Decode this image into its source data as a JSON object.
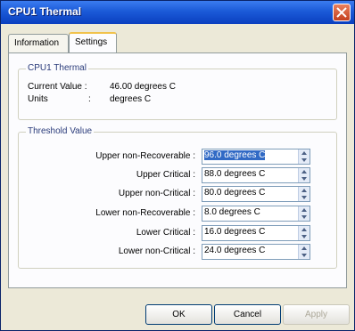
{
  "window": {
    "title": "CPU1 Thermal"
  },
  "tabs": [
    {
      "label": "Information",
      "active": false
    },
    {
      "label": "Settings",
      "active": true
    }
  ],
  "sensor_group": {
    "legend": "CPU1 Thermal",
    "current_value_label": "Current Value :",
    "current_value": "46.00 degrees C",
    "units_label": "Units",
    "units_sep": ":",
    "units_value": "degrees C"
  },
  "threshold_group": {
    "legend": "Threshold Value",
    "rows": [
      {
        "label": "Upper non-Recoverable :",
        "value": "96.0 degrees C",
        "selected": true
      },
      {
        "label": "Upper Critical :",
        "value": "88.0 degrees C",
        "selected": false
      },
      {
        "label": "Upper non-Critical :",
        "value": "80.0 degrees C",
        "selected": false
      },
      {
        "label": "Lower non-Recoverable :",
        "value": "8.0 degrees C",
        "selected": false
      },
      {
        "label": "Lower Critical :",
        "value": "16.0 degrees C",
        "selected": false
      },
      {
        "label": "Lower non-Critical :",
        "value": "24.0 degrees C",
        "selected": false
      }
    ]
  },
  "buttons": {
    "ok": "OK",
    "cancel": "Cancel",
    "apply": "Apply"
  },
  "colors": {
    "titlebar": "#1b5ad8",
    "selection": "#316ac5",
    "dialog_bg": "#ece9d8"
  }
}
